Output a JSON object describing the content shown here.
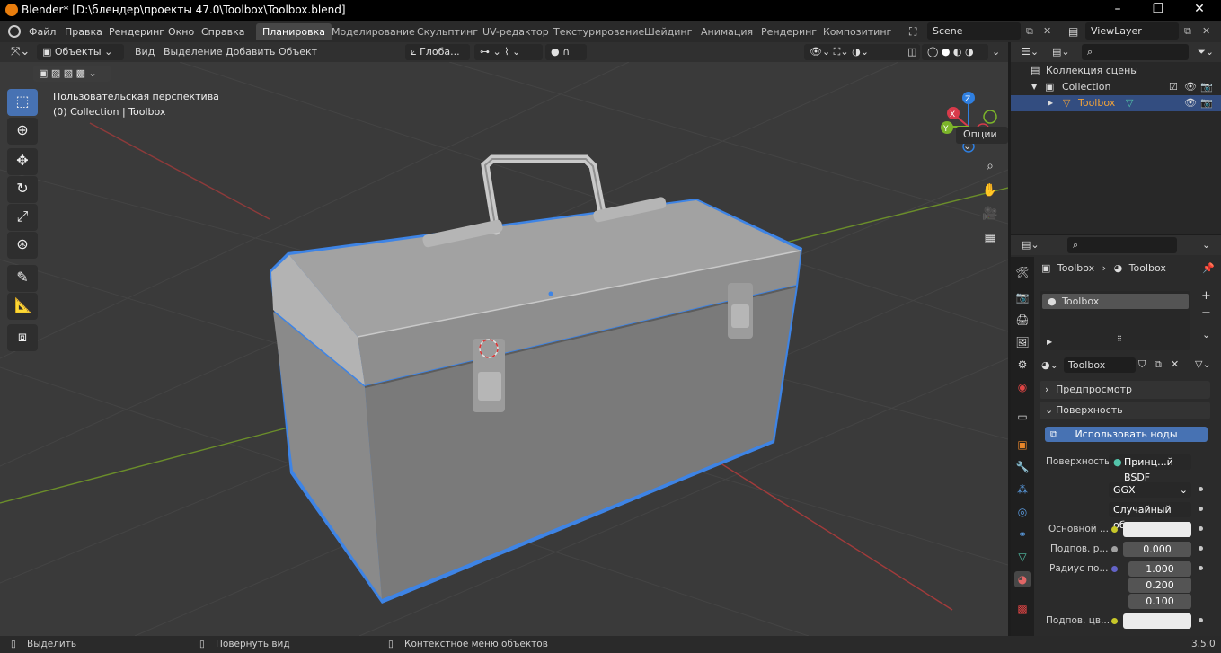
{
  "window": {
    "title": "Blender* [D:\\блендер\\проекты 47.0\\Toolbox\\Toolbox.blend]"
  },
  "menu": [
    "Файл",
    "Правка",
    "Рендеринг",
    "Окно",
    "Справка"
  ],
  "workspaces": [
    "Планировка",
    "Моделирование",
    "Скульптинг",
    "UV-редактор",
    "Текстурирование",
    "Шейдинг",
    "Анимация",
    "Рендеринг",
    "Композитинг"
  ],
  "scene": "Scene",
  "view_layer": "ViewLayer",
  "header": {
    "mode": "Объекты",
    "view": "Вид",
    "select": "Выделение",
    "add": "Добавить",
    "object": "Объект",
    "orientation": "Глоба...",
    "options": "Опции"
  },
  "viewport": {
    "persp": "Пользовательская перспектива",
    "collection": "(0) Collection | Toolbox"
  },
  "gizmo": {
    "z": "Z",
    "y": "Y",
    "x": "X"
  },
  "outliner": {
    "scene_collection": "Коллекция сцены",
    "collection": "Collection",
    "object": "Toolbox"
  },
  "props": {
    "crumb_obj": "Toolbox",
    "crumb_mat": "Toolbox",
    "slot": "Toolbox",
    "material": "Toolbox",
    "preview": "Предпросмотр",
    "surface_panel": "Поверхность",
    "use_nodes": "Использовать ноды",
    "surface_label": "Поверхность",
    "surface_value": "Принц...й BSDF",
    "distribution": "GGX",
    "subsurface_method": "Случайный об...",
    "base_color": "Основной ...",
    "subsurface": "Подпов. р...",
    "subsurface_value": "0.000",
    "radius": "Радиус по...",
    "radius_values": [
      "1.000",
      "0.200",
      "0.100"
    ],
    "subsurface_color": "Подпов. цв..."
  },
  "status": {
    "select": "Выделить",
    "rotate": "Повернуть вид",
    "context": "Контекстное меню объектов",
    "version": "3.5.0"
  },
  "colors": {
    "accent": "#4772b3",
    "active_tab": "#474747",
    "selection": "#3e84e5",
    "x_axis": "#d83a4a",
    "y_axis": "#7cb52a",
    "z_axis": "#2f7fe0"
  }
}
